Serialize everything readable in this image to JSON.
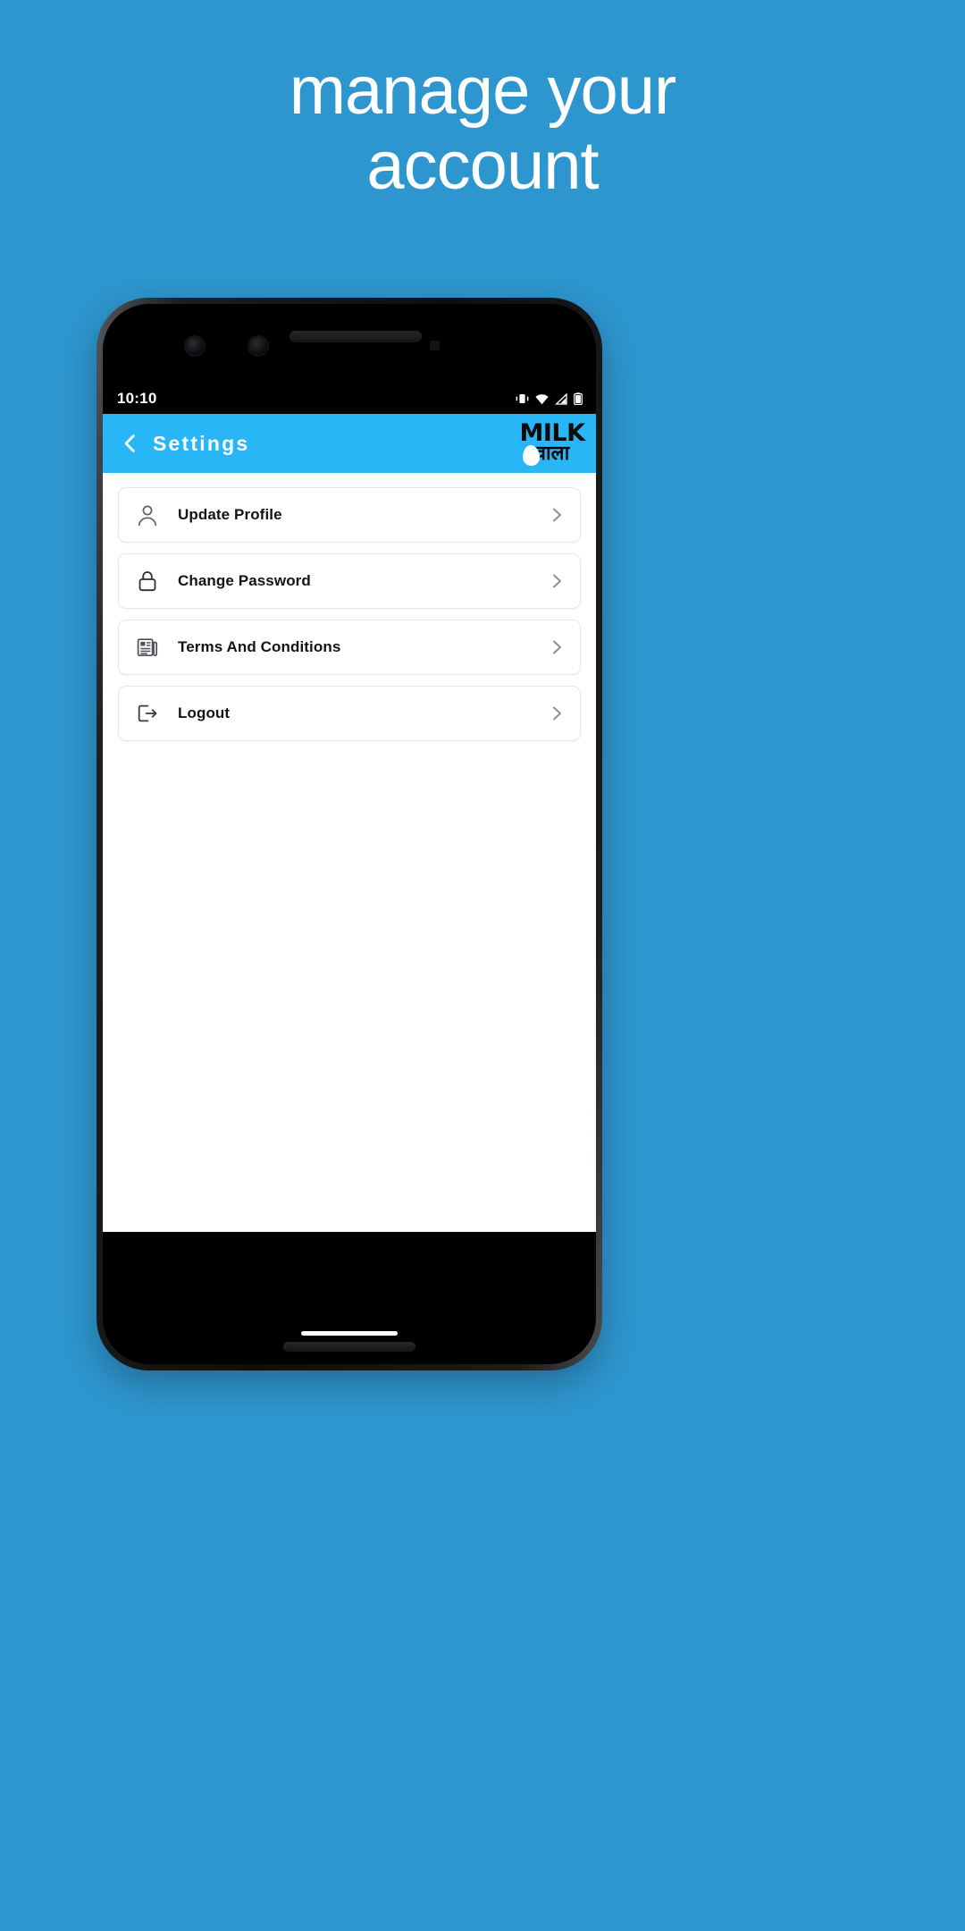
{
  "promo": {
    "line1": "manage your",
    "line2": "account"
  },
  "colors": {
    "page_background": "#2e96ce",
    "appbar": "#29b6f6",
    "screen_background": "#ffffff",
    "statusbar": "#000000",
    "row_border": "#e4e6e8",
    "text_primary": "#141414"
  },
  "phone": {
    "statusbar": {
      "time": "10:10",
      "icons": [
        "vibrate-icon",
        "wifi-icon",
        "signal-icon",
        "battery-icon"
      ]
    },
    "appbar": {
      "back_icon": "chevron-left-icon",
      "title": "Settings",
      "brand": {
        "name": "MILK",
        "subtitle": "वाला",
        "drop": "milk-drop-icon"
      }
    },
    "settings_list": [
      {
        "label": "Update Profile",
        "icon": "user-icon",
        "chevron": "chevron-right-icon"
      },
      {
        "label": "Change Password",
        "icon": "lock-icon",
        "chevron": "chevron-right-icon"
      },
      {
        "label": "Terms And Conditions",
        "icon": "document-icon",
        "chevron": "chevron-right-icon"
      },
      {
        "label": "Logout",
        "icon": "logout-icon",
        "chevron": "chevron-right-icon"
      }
    ],
    "navigation": {
      "home_indicator": "home-indicator"
    }
  }
}
